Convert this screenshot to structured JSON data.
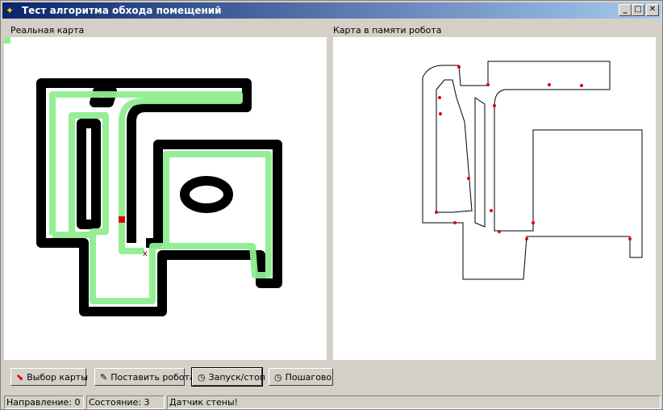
{
  "window": {
    "title": "Тест алгоритма обхода помещений",
    "minimize": "_",
    "maximize": "□",
    "close": "✕"
  },
  "panels": {
    "real_map_label": "Реальная карта",
    "robot_map_label": "Карта в памяти робота"
  },
  "buttons": [
    {
      "label": "Выбор карты",
      "icon": "map-select-icon"
    },
    {
      "label": "Поставить робота",
      "icon": "pencil-icon"
    },
    {
      "label": "Запуск/стоп",
      "icon": "clock-icon"
    },
    {
      "label": "Пошагово",
      "icon": "clock-icon"
    }
  ],
  "status": {
    "direction": "Направление: 0",
    "state": "Состояние: 3",
    "message": "Датчик стены!"
  },
  "colors": {
    "path": "#90ee90",
    "robot": "#e00000",
    "wall": "#000000"
  }
}
